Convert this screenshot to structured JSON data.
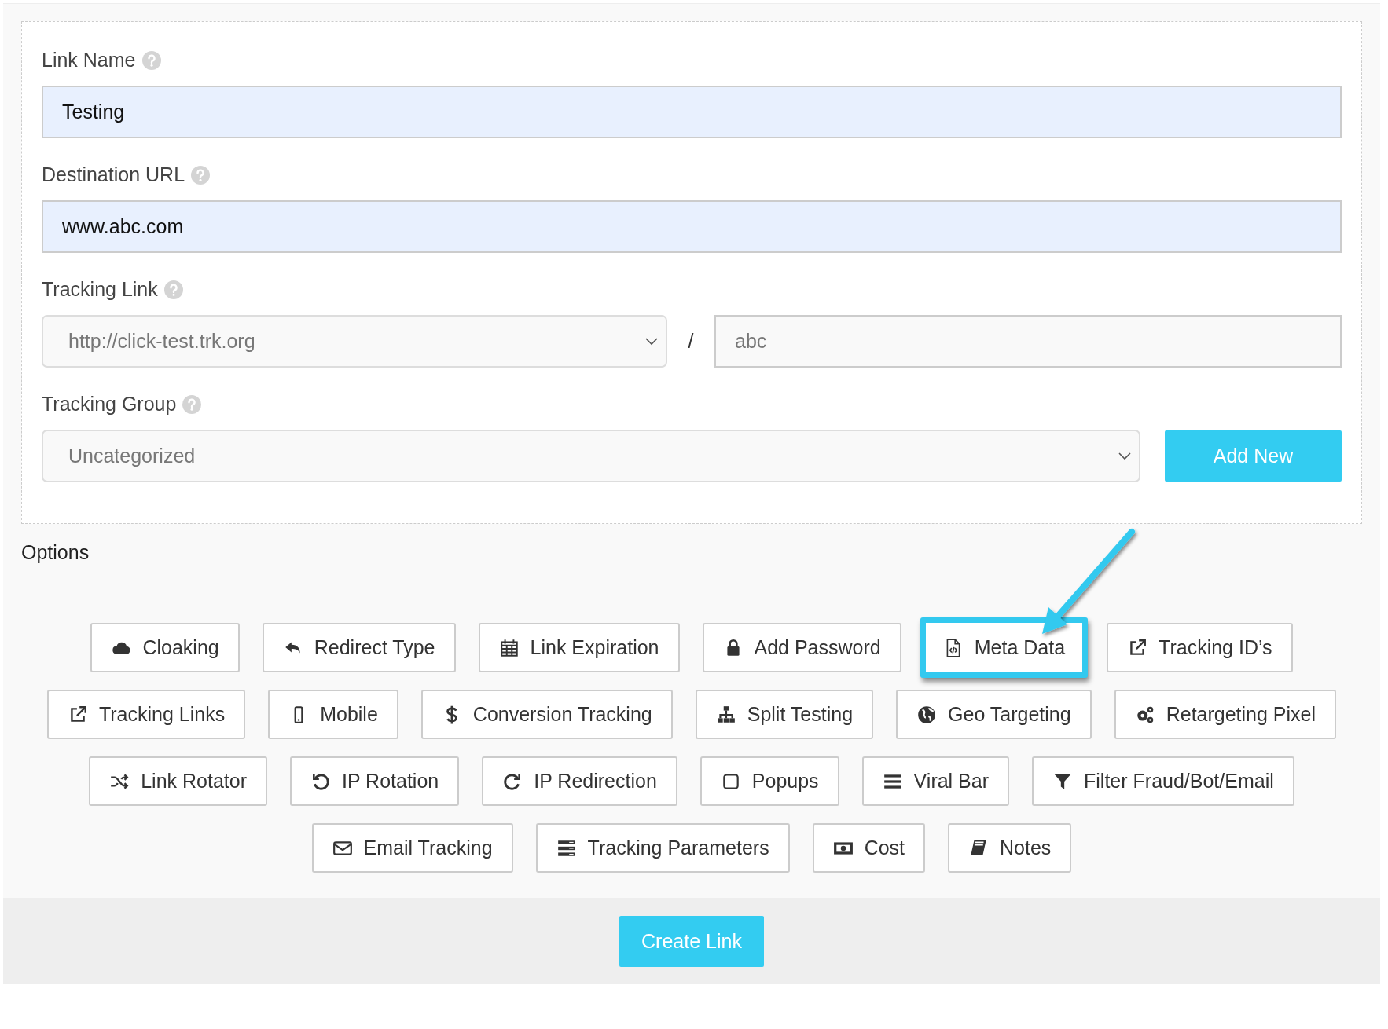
{
  "form": {
    "fields": [
      {
        "kind": "text",
        "label": "Link Name",
        "value": "Testing"
      },
      {
        "kind": "text",
        "label": "Destination URL",
        "value": "www.abc.com"
      },
      {
        "kind": "link",
        "label": "Tracking Link",
        "domain": "http://click-test.trk.org",
        "separator": "/",
        "slug": "abc"
      },
      {
        "kind": "group",
        "label": "Tracking Group",
        "value": "Uncategorized",
        "button": "Add New"
      }
    ]
  },
  "options": {
    "title": "Options",
    "items": [
      {
        "label": "Cloaking",
        "highlighted": false
      },
      {
        "label": "Redirect Type",
        "highlighted": false
      },
      {
        "label": "Link Expiration",
        "highlighted": false
      },
      {
        "label": "Add Password",
        "highlighted": false
      },
      {
        "label": "Meta Data",
        "highlighted": true
      },
      {
        "label": "Tracking ID’s",
        "highlighted": false
      },
      {
        "label": "Tracking Links",
        "highlighted": false
      },
      {
        "label": "Mobile",
        "highlighted": false
      },
      {
        "label": "Conversion Tracking",
        "highlighted": false
      },
      {
        "label": "Split Testing",
        "highlighted": false
      },
      {
        "label": "Geo Targeting",
        "highlighted": false
      },
      {
        "label": "Retargeting Pixel",
        "highlighted": false
      },
      {
        "label": "Link Rotator",
        "highlighted": false
      },
      {
        "label": "IP Rotation",
        "highlighted": false
      },
      {
        "label": "IP Redirection",
        "highlighted": false
      },
      {
        "label": "Popups",
        "highlighted": false
      },
      {
        "label": "Viral Bar",
        "highlighted": false
      },
      {
        "label": "Filter Fraud/Bot/Email",
        "highlighted": false
      },
      {
        "label": "Email Tracking",
        "highlighted": false
      },
      {
        "label": "Tracking Parameters",
        "highlighted": false
      },
      {
        "label": "Cost",
        "highlighted": false
      },
      {
        "label": "Notes",
        "highlighted": false
      }
    ]
  },
  "footer": {
    "button": "Create Link"
  }
}
